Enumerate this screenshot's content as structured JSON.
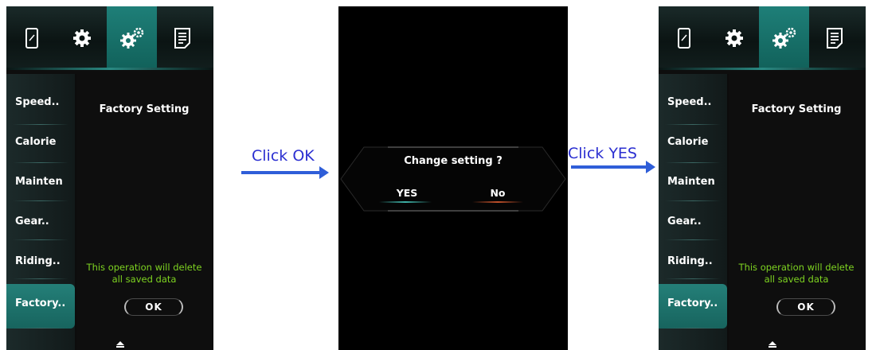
{
  "screens": [
    {
      "tabs": [
        "phone-icon",
        "gear-icon",
        "gears-icon",
        "document-icon"
      ],
      "sidebar": [
        "Speed..",
        "Calorie",
        "Mainten",
        "Gear..",
        "Riding..",
        "Factory.."
      ],
      "title": "Factory Setting",
      "warning_line1": "This operation will delete",
      "warning_line2": "all saved data",
      "ok_label": "OK"
    },
    {
      "tabs": [
        "phone-icon",
        "gear-icon",
        "gears-icon",
        "document-icon"
      ],
      "sidebar": [
        "Speed..",
        "Calorie",
        "Mainten",
        "Gear..",
        "Riding..",
        "Factory.."
      ],
      "title": "Factory Setting",
      "warning_line1": "This operation will delete",
      "warning_line2": "all saved data",
      "ok_label": "OK"
    }
  ],
  "dialog": {
    "title": "Change setting ?",
    "yes": "YES",
    "no": "No"
  },
  "steps": [
    "Click OK",
    "Click YES"
  ],
  "colors": {
    "accent": "#1e7f78",
    "warning": "#7ed321",
    "arrow": "#2f5ed8",
    "label": "#2b2fd1"
  }
}
